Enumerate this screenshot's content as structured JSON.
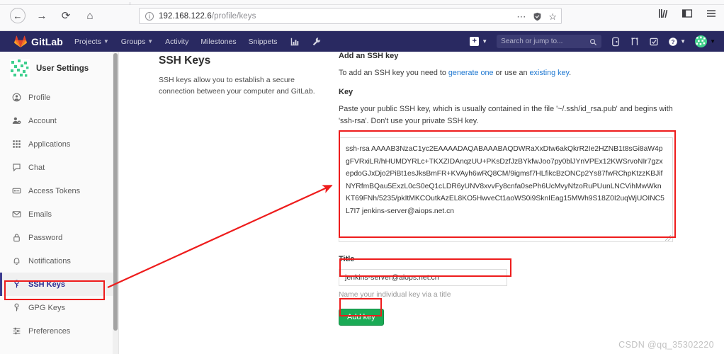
{
  "browser": {
    "back_icon": "back-arrow-icon",
    "forward_icon": "forward-arrow-icon",
    "reload_icon": "reload-icon",
    "home_icon": "home-icon",
    "url_host": "192.168.122.6",
    "url_path": "/profile/keys",
    "url_full": "192.168.122.6/profile/keys",
    "site_info_icon": "info-circle-icon",
    "page_actions_icon": "ellipsis-icon",
    "shield_icon": "shield-icon",
    "bookmark_icon": "star-icon",
    "library_icon": "library-icon",
    "sidebar_icon": "sidebar-toggle-icon",
    "menu_icon": "hamburger-menu-icon"
  },
  "navbar": {
    "brand": "GitLab",
    "logo_icon": "gitlab-tanuki-logo",
    "items": [
      {
        "label": "Projects",
        "has_caret": true
      },
      {
        "label": "Groups",
        "has_caret": true
      },
      {
        "label": "Activity",
        "has_caret": false
      },
      {
        "label": "Milestones",
        "has_caret": false
      },
      {
        "label": "Snippets",
        "has_caret": false
      }
    ],
    "icon_items": [
      {
        "icon": "analytics-chart-icon"
      },
      {
        "icon": "wrench-icon"
      }
    ],
    "create_new_icon": "plus-square-icon",
    "search_placeholder": "Search or jump to...",
    "search_icon": "magnifier-icon",
    "right_icons": [
      {
        "icon": "issues-icon"
      },
      {
        "icon": "merge-request-icon"
      },
      {
        "icon": "todos-check-icon"
      }
    ],
    "help_icon": "question-circle-icon",
    "avatar_icon": "user-avatar",
    "bg_color": "#292961"
  },
  "sidebar": {
    "header": "User Settings",
    "avatar_icon": "identicon-avatar",
    "items": [
      {
        "label": "Profile",
        "icon": "user-circle-icon",
        "active": false
      },
      {
        "label": "Account",
        "icon": "account-gear-icon",
        "active": false
      },
      {
        "label": "Applications",
        "icon": "applications-grid-icon",
        "active": false
      },
      {
        "label": "Chat",
        "icon": "chat-bubble-icon",
        "active": false
      },
      {
        "label": "Access Tokens",
        "icon": "token-card-icon",
        "active": false
      },
      {
        "label": "Emails",
        "icon": "envelope-icon",
        "active": false
      },
      {
        "label": "Password",
        "icon": "lock-icon",
        "active": false
      },
      {
        "label": "Notifications",
        "icon": "bell-icon",
        "active": false
      },
      {
        "label": "SSH Keys",
        "icon": "key-icon",
        "active": true
      },
      {
        "label": "GPG Keys",
        "icon": "key-icon",
        "active": false
      },
      {
        "label": "Preferences",
        "icon": "sliders-icon",
        "active": false
      }
    ],
    "active_item": "SSH Keys"
  },
  "left_column": {
    "heading": "SSH Keys",
    "description": "SSH keys allow you to establish a secure connection between your computer and GitLab."
  },
  "form": {
    "heading": "Add an SSH key",
    "intro_before": "To add an SSH key you need to ",
    "link_generate": "generate one",
    "intro_middle": " or use an ",
    "link_existing": "existing key",
    "intro_after": ".",
    "key_label": "Key",
    "key_help": "Paste your public SSH key, which is usually contained in the file '~/.ssh/id_rsa.pub' and begins with 'ssh-rsa'. Don't use your private SSH key.",
    "key_value": "ssh-rsa AAAAB3NzaC1yc2EAAAADAQABAAABAQDWRaXxDtw6akQkrR2Ie2HZNB1t8sGi8aW4pgFVRxiLR/hHUMDYRLc+TKXZIDAnqzUU+PKsDzfJzBYkfwJoo7py0blJYnVPEx12KWSrvoNIr7gzxepdoGJxDjo2PiBt1esJksBmFR+KVAyh6wRQ8CM/9igmsf7HLfikcBzONCp2Ys87fwRChpKtzzKBJifNYRfmBQau5ExzL0cS0eQ1cLDR6yUNV8xvvFy8cnfa0sePh6UcMvyNfzoRuPUunLNCVihMwWknKT69FNh/5235/pkItMKCOutkAzEL8KO5HwveCt1aoWS0i9SknIEag15MWh9S18Z0I2uqWjUOINC5L7I7 jenkins-server@aiops.net.cn",
    "key_placeholder": "",
    "title_label": "Title",
    "title_value": "jenkins-server@aiops.net.cn",
    "title_hint": "Name your individual key via a title",
    "submit_label": "Add key",
    "submit_color": "#1aaa55"
  },
  "annotations": {
    "color": "#ee1c1c",
    "boxes": [
      "sidebar-ssh-keys",
      "key-textarea",
      "title-input",
      "add-key-button"
    ],
    "arrow": "from SSH Keys sidebar item to key textarea"
  },
  "watermark": "CSDN @qq_35302220"
}
